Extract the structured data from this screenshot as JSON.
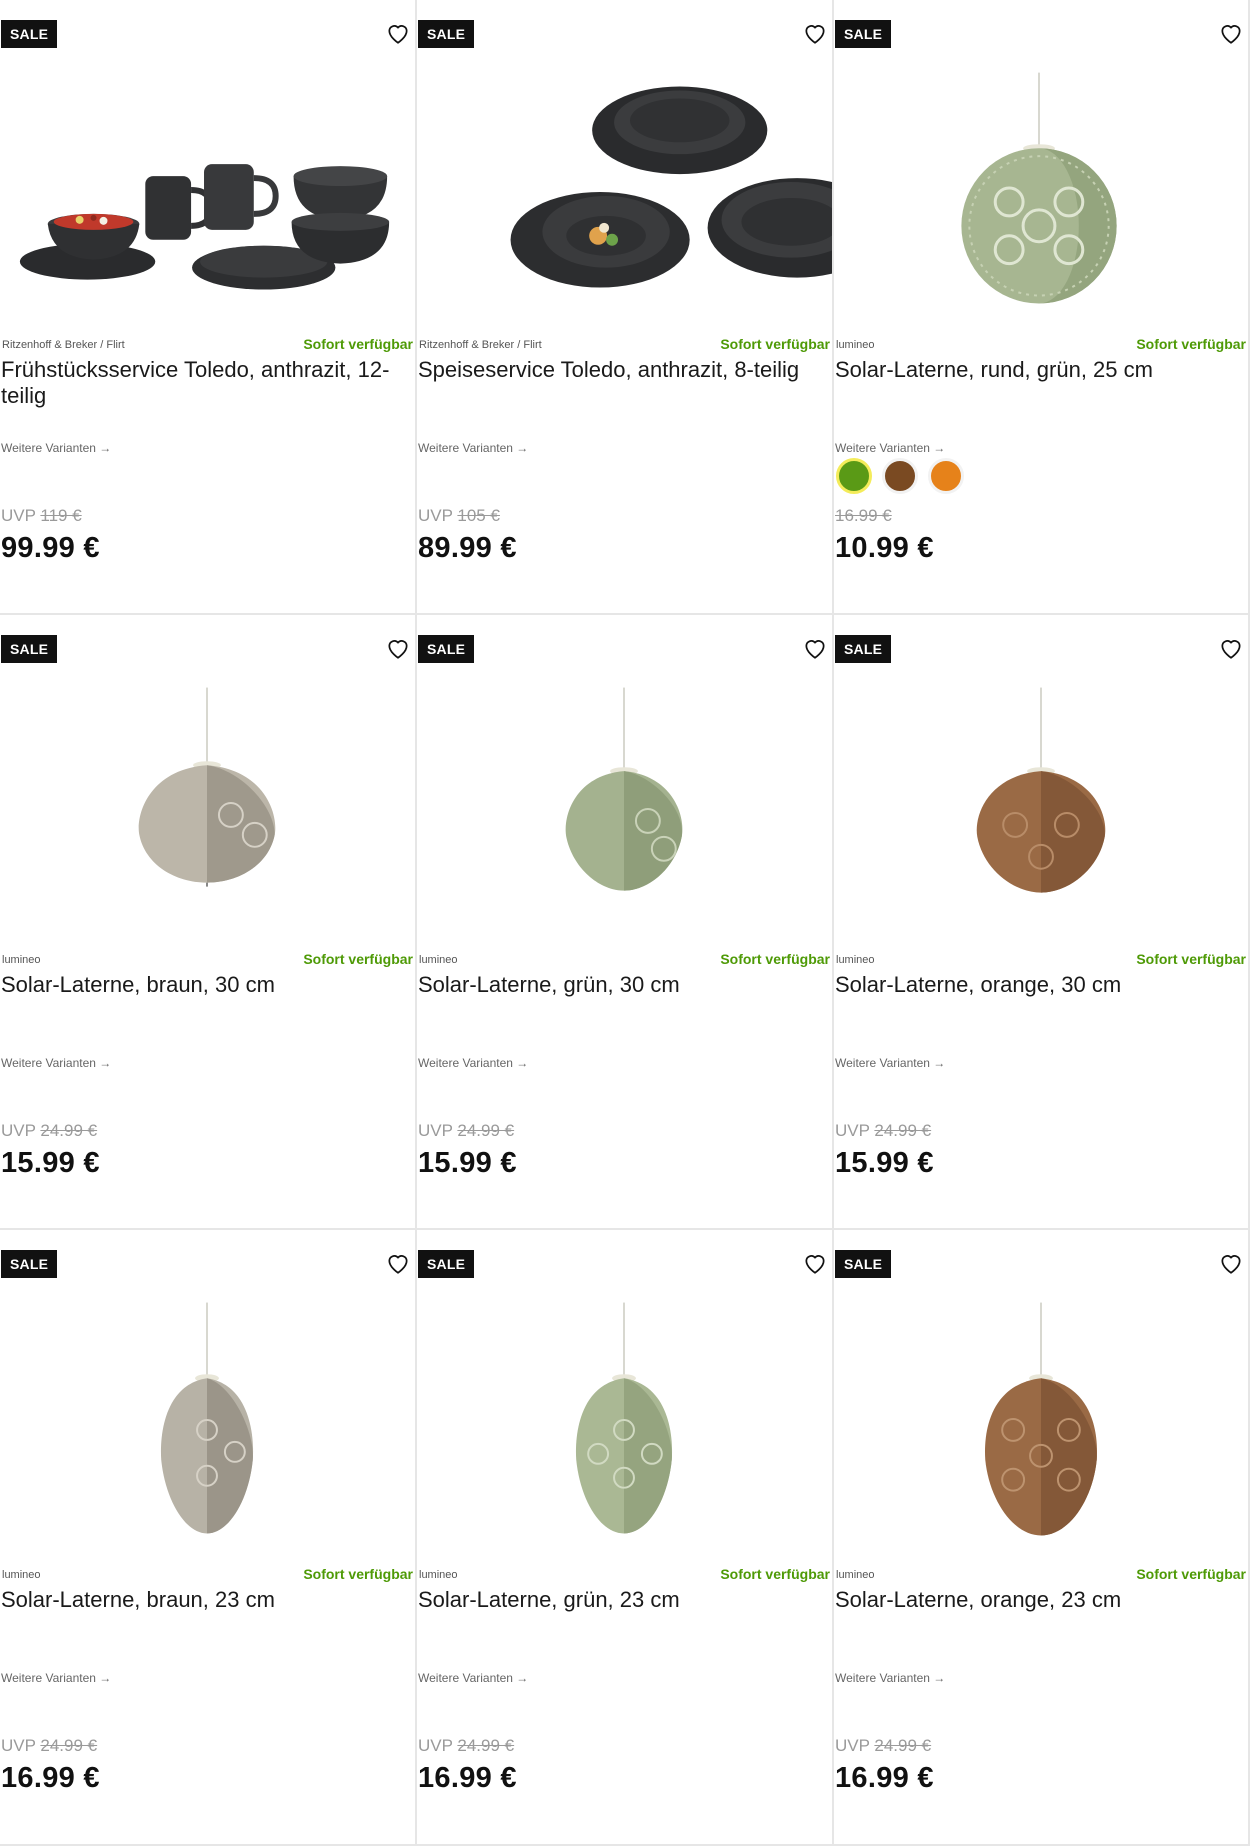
{
  "products": [
    {
      "badge": "SALE",
      "brand": "Ritzenhoff & Breker / Flirt",
      "availability": "Sofort verfügbar",
      "title": "Frühstücksservice Toledo, anthrazit, 12-teilig",
      "variants_link": "Weitere Varianten →",
      "uvp_label": "UVP",
      "old_price": "119 €",
      "price": "99.99 €",
      "image": "breakfast-set"
    },
    {
      "badge": "SALE",
      "brand": "Ritzenhoff & Breker / Flirt",
      "availability": "Sofort verfügbar",
      "title": "Speiseservice Toledo, anthrazit, 8-teilig",
      "variants_link": "Weitere Varianten →",
      "uvp_label": "UVP",
      "old_price": "105 €",
      "price": "89.99 €",
      "image": "dinner-set"
    },
    {
      "badge": "SALE",
      "brand": "lumineo",
      "availability": "Sofort verfügbar",
      "title": "Solar-Laterne, rund, grün, 25 cm",
      "variants_link": "Weitere Varianten →",
      "uvp_label": "",
      "old_price": "16.99 €",
      "price": "10.99 €",
      "image": "lantern-round-green",
      "swatches": [
        "#5a9a16",
        "#7a4a22",
        "#e6821a"
      ]
    },
    {
      "badge": "SALE",
      "brand": "lumineo",
      "availability": "Sofort verfügbar",
      "title": "Solar-Laterne, braun, 30 cm",
      "variants_link": "Weitere Varianten →",
      "uvp_label": "UVP",
      "old_price": "24.99 €",
      "price": "15.99 €",
      "image": "lantern-30-brown"
    },
    {
      "badge": "SALE",
      "brand": "lumineo",
      "availability": "Sofort verfügbar",
      "title": "Solar-Laterne, grün, 30 cm",
      "variants_link": "Weitere Varianten →",
      "uvp_label": "UVP",
      "old_price": "24.99 €",
      "price": "15.99 €",
      "image": "lantern-30-green"
    },
    {
      "badge": "SALE",
      "brand": "lumineo",
      "availability": "Sofort verfügbar",
      "title": "Solar-Laterne, orange, 30 cm",
      "variants_link": "Weitere Varianten →",
      "uvp_label": "UVP",
      "old_price": "24.99 €",
      "price": "15.99 €",
      "image": "lantern-30-orange"
    },
    {
      "badge": "SALE",
      "brand": "lumineo",
      "availability": "Sofort verfügbar",
      "title": "Solar-Laterne, braun, 23 cm",
      "variants_link": "Weitere Varianten →",
      "uvp_label": "UVP",
      "old_price": "24.99 €",
      "price": "16.99 €",
      "image": "lantern-23-brown"
    },
    {
      "badge": "SALE",
      "brand": "lumineo",
      "availability": "Sofort verfügbar",
      "title": "Solar-Laterne, grün, 23 cm",
      "variants_link": "Weitere Varianten →",
      "uvp_label": "UVP",
      "old_price": "24.99 €",
      "price": "16.99 €",
      "image": "lantern-23-green"
    },
    {
      "badge": "SALE",
      "brand": "lumineo",
      "availability": "Sofort verfügbar",
      "title": "Solar-Laterne, orange, 23 cm",
      "variants_link": "Weitere Varianten →",
      "uvp_label": "UVP",
      "old_price": "24.99 €",
      "price": "16.99 €",
      "image": "lantern-23-orange"
    }
  ],
  "colors": {
    "availability": "#4e9a06",
    "sale_badge": "#111111",
    "old_price": "#9a9a9a"
  },
  "icons": {
    "favorite": "heart-outline-icon",
    "arrow": "arrow-right-icon"
  }
}
